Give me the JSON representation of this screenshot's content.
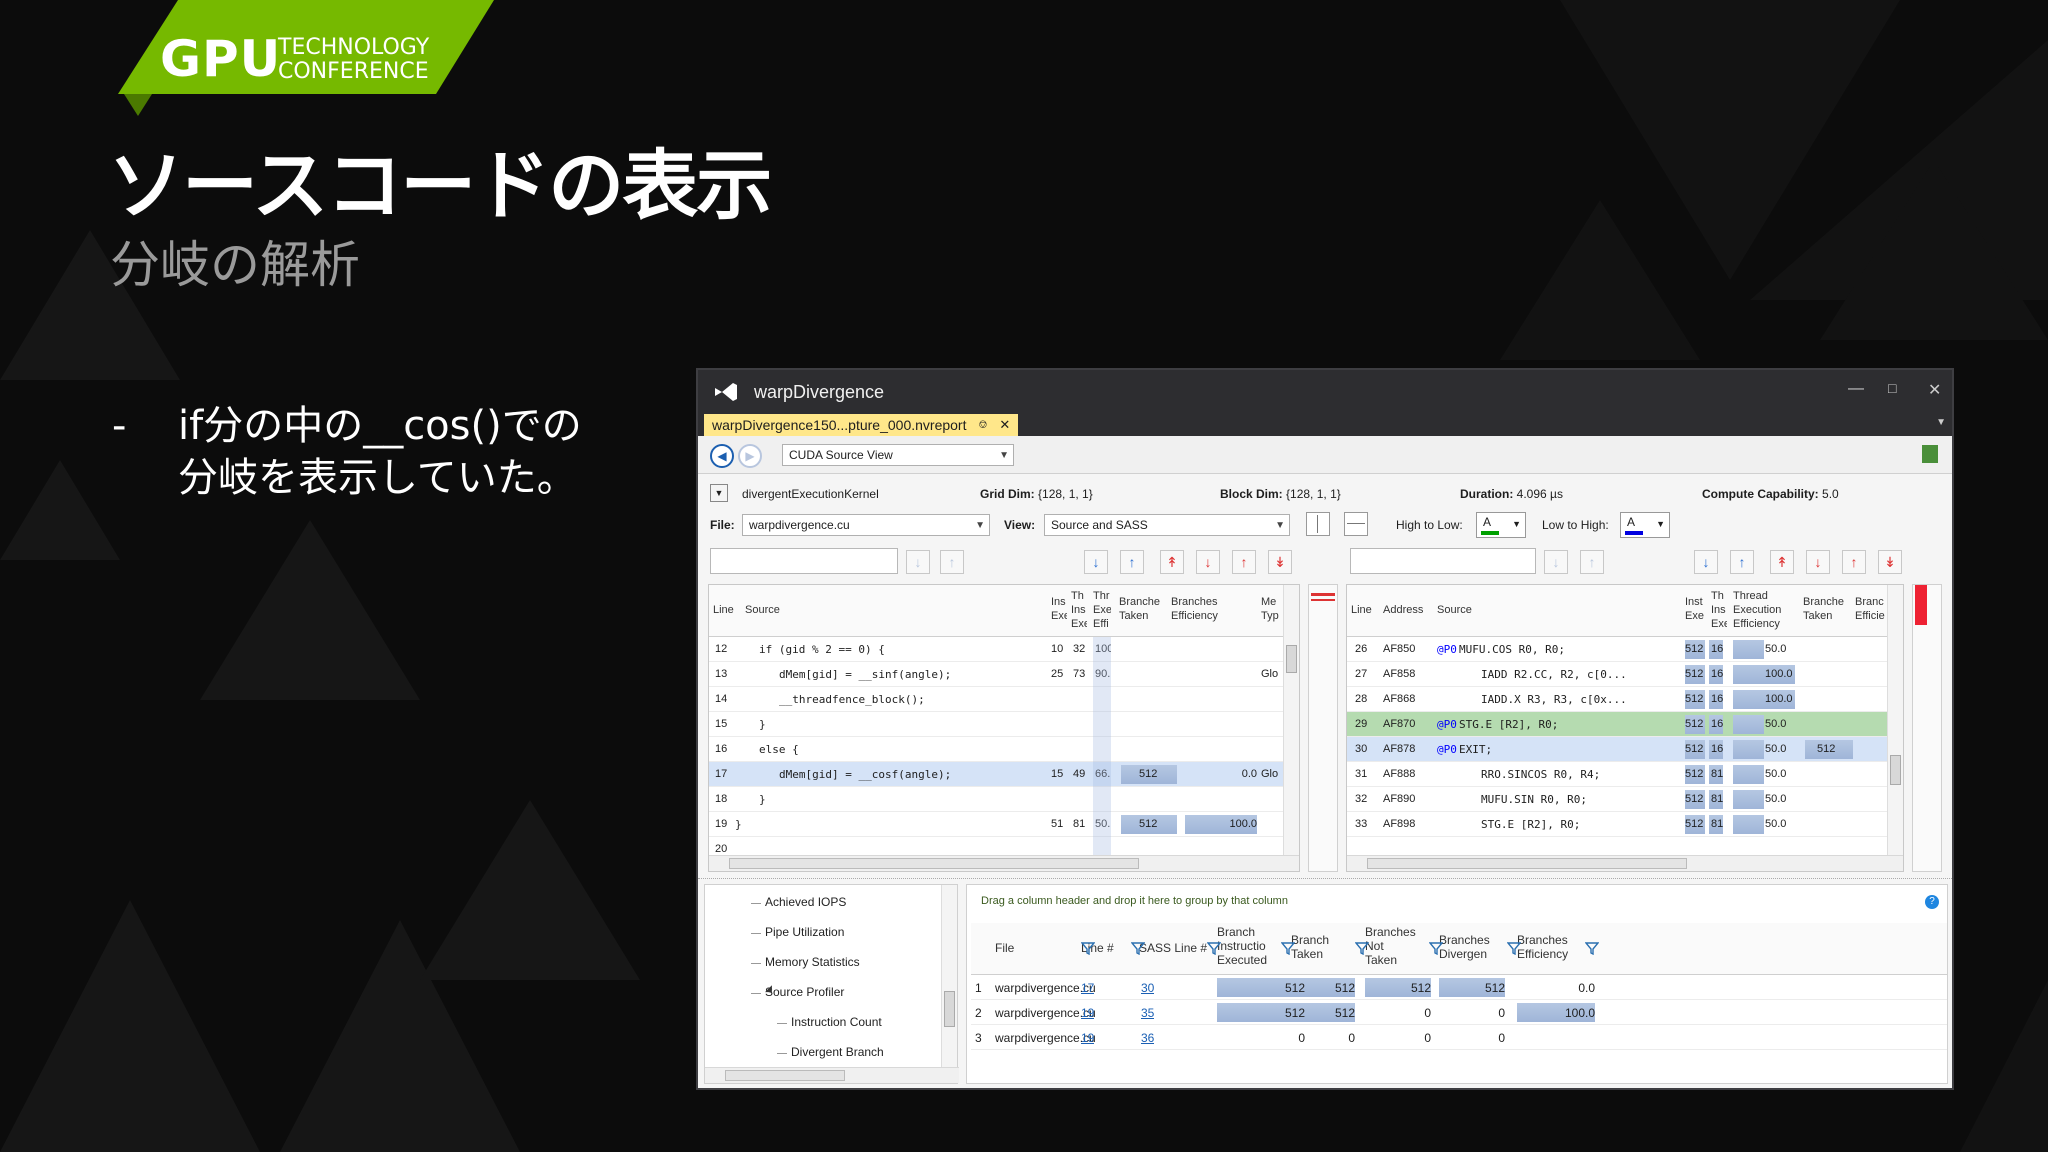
{
  "slide": {
    "logo_gpu": "GPU",
    "logo_tech_line1": "TECHNOLOGY",
    "logo_tech_line2": "CONFERENCE",
    "title": "ソースコードの表示",
    "subtitle": "分岐の解析",
    "bullet_dash": "-",
    "bullet_line1": "if分の中の__cos()での",
    "bullet_line2": "分岐を表示していた。",
    "accent_color": "#76b900"
  },
  "window": {
    "title": "warpDivergence",
    "doc_tab": "warpDivergence150...pture_000.nvreport",
    "view_combo": "CUDA Source View",
    "kernel": "divergentExecutionKernel",
    "grid_dim_label": "Grid Dim:",
    "grid_dim_value": "{128, 1, 1}",
    "block_dim_label": "Block Dim:",
    "block_dim_value": "{128, 1, 1}",
    "duration_label": "Duration:",
    "duration_value": "4.096  µs",
    "cc_label": "Compute Capability:",
    "cc_value": "5.0",
    "file_label": "File:",
    "file_value": "warpdivergence.cu",
    "view_label": "View:",
    "view_value": "Source and SASS",
    "high_low_label": "High to Low:",
    "low_high_label": "Low to High:",
    "swatch_letter": "A"
  },
  "source_grid": {
    "headers": {
      "line": "Line",
      "source": "Source",
      "ins1": "Ins",
      "ins2": "Exe",
      "th1": "Th",
      "th2": "Ins",
      "th3": "Exe",
      "thr1": "Thr",
      "thr2": "Exe",
      "thr3": "Effi",
      "bt1": "Branche",
      "bt2": "Taken",
      "be1": "Branches",
      "be2": "Efficiency",
      "mt1": "Me",
      "mt2": "Typ"
    },
    "rows": [
      {
        "line": "12",
        "code": "if (gid % 2 == 0) {",
        "c1": "10",
        "c2": "32",
        "c3": "100",
        "bt": "",
        "be": "",
        "mt": ""
      },
      {
        "line": "13",
        "code": "dMem[gid] = __sinf(angle);",
        "c1": "25",
        "c2": "73",
        "c3": "90.",
        "bt": "",
        "be": "",
        "mt": "Glo"
      },
      {
        "line": "14",
        "code": "__threadfence_block();",
        "c1": "",
        "c2": "",
        "c3": "",
        "bt": "",
        "be": "",
        "mt": ""
      },
      {
        "line": "15",
        "code": "}",
        "c1": "",
        "c2": "",
        "c3": "",
        "bt": "",
        "be": "",
        "mt": ""
      },
      {
        "line": "16",
        "code": "else {",
        "c1": "",
        "c2": "",
        "c3": "",
        "bt": "",
        "be": "",
        "mt": ""
      },
      {
        "line": "17",
        "code": "dMem[gid] = __cosf(angle);",
        "c1": "15",
        "c2": "49",
        "c3": "66.",
        "bt": "512",
        "be": "0.0",
        "mt": "Glo"
      },
      {
        "line": "18",
        "code": "}",
        "c1": "",
        "c2": "",
        "c3": "",
        "bt": "",
        "be": "",
        "mt": ""
      },
      {
        "line": "19",
        "code": "}",
        "c1": "51",
        "c2": "81",
        "c3": "50.",
        "bt": "512",
        "be": "100.0",
        "mt": ""
      },
      {
        "line": "20",
        "code": "",
        "c1": "",
        "c2": "",
        "c3": "",
        "bt": "",
        "be": "",
        "mt": ""
      }
    ]
  },
  "sass_grid": {
    "headers": {
      "line": "Line",
      "address": "Address",
      "source": "Source",
      "inst1": "Inst",
      "inst2": "Exe",
      "th1": "Th",
      "th2": "Ins",
      "th3": "Exe",
      "tee1": "Thread",
      "tee2": "Execution",
      "tee3": "Efficiency",
      "bt1": "Branche",
      "bt2": "Taken",
      "be1": "Branc",
      "be2": "Efficie"
    },
    "rows": [
      {
        "line": "26",
        "addr": "AF850",
        "pred": "@P0",
        "code": "MUFU.COS R0, R0;",
        "c1": "512",
        "c2": "16",
        "tee": "50.0",
        "bt": ""
      },
      {
        "line": "27",
        "addr": "AF858",
        "pred": "",
        "code": "IADD R2.CC, R2, c[0...",
        "c1": "512",
        "c2": "16",
        "tee": "100.0",
        "bt": ""
      },
      {
        "line": "28",
        "addr": "AF868",
        "pred": "",
        "code": "IADD.X R3, R3, c[0x...",
        "c1": "512",
        "c2": "16",
        "tee": "100.0",
        "bt": ""
      },
      {
        "line": "29",
        "addr": "AF870",
        "pred": "@P0",
        "code": "STG.E [R2], R0;",
        "c1": "512",
        "c2": "16",
        "tee": "50.0",
        "bt": ""
      },
      {
        "line": "30",
        "addr": "AF878",
        "pred": "@P0",
        "code": "EXIT;",
        "c1": "512",
        "c2": "16",
        "tee": "50.0",
        "bt": "512"
      },
      {
        "line": "31",
        "addr": "AF888",
        "pred": "",
        "code": "RRO.SINCOS R0, R4;",
        "c1": "512",
        "c2": "81",
        "tee": "50.0",
        "bt": ""
      },
      {
        "line": "32",
        "addr": "AF890",
        "pred": "",
        "code": "MUFU.SIN R0, R0;",
        "c1": "512",
        "c2": "81",
        "tee": "50.0",
        "bt": ""
      },
      {
        "line": "33",
        "addr": "AF898",
        "pred": "",
        "code": "STG.E [R2], R0;",
        "c1": "512",
        "c2": "81",
        "tee": "50.0",
        "bt": ""
      }
    ]
  },
  "tree": {
    "items": [
      "Achieved IOPS",
      "Pipe Utilization",
      "Memory Statistics",
      "Source Profiler",
      "Instruction Count",
      "Divergent Branch"
    ]
  },
  "bottom_grid": {
    "group_hint": "Drag a column header and drop it here to group by that column",
    "help": "?",
    "headers": {
      "file": "File",
      "line": "Line #",
      "sass": "SASS Line #",
      "bie1": "Branch",
      "bie2": "Instructio",
      "bie3": "Executed",
      "bt1": "Branch",
      "bt2": "Taken",
      "bnt1": "Branches",
      "bnt2": "Not",
      "bnt3": "Taken",
      "bd1": "Branches",
      "bd2": "Divergen",
      "be1": "Branches",
      "be2": "Efficiency"
    },
    "rows": [
      {
        "idx": "1",
        "file": "warpdivergence.cu",
        "line": "17",
        "sass": "30",
        "bie": "512",
        "bt": "512",
        "bnt": "512",
        "bd": "512",
        "be": "0.0"
      },
      {
        "idx": "2",
        "file": "warpdivergence.cu",
        "line": "19",
        "sass": "35",
        "bie": "512",
        "bt": "512",
        "bnt": "0",
        "bd": "0",
        "be": "100.0"
      },
      {
        "idx": "3",
        "file": "warpdivergence.cu",
        "line": "19",
        "sass": "36",
        "bie": "0",
        "bt": "0",
        "bnt": "0",
        "bd": "0",
        "be": ""
      }
    ]
  }
}
